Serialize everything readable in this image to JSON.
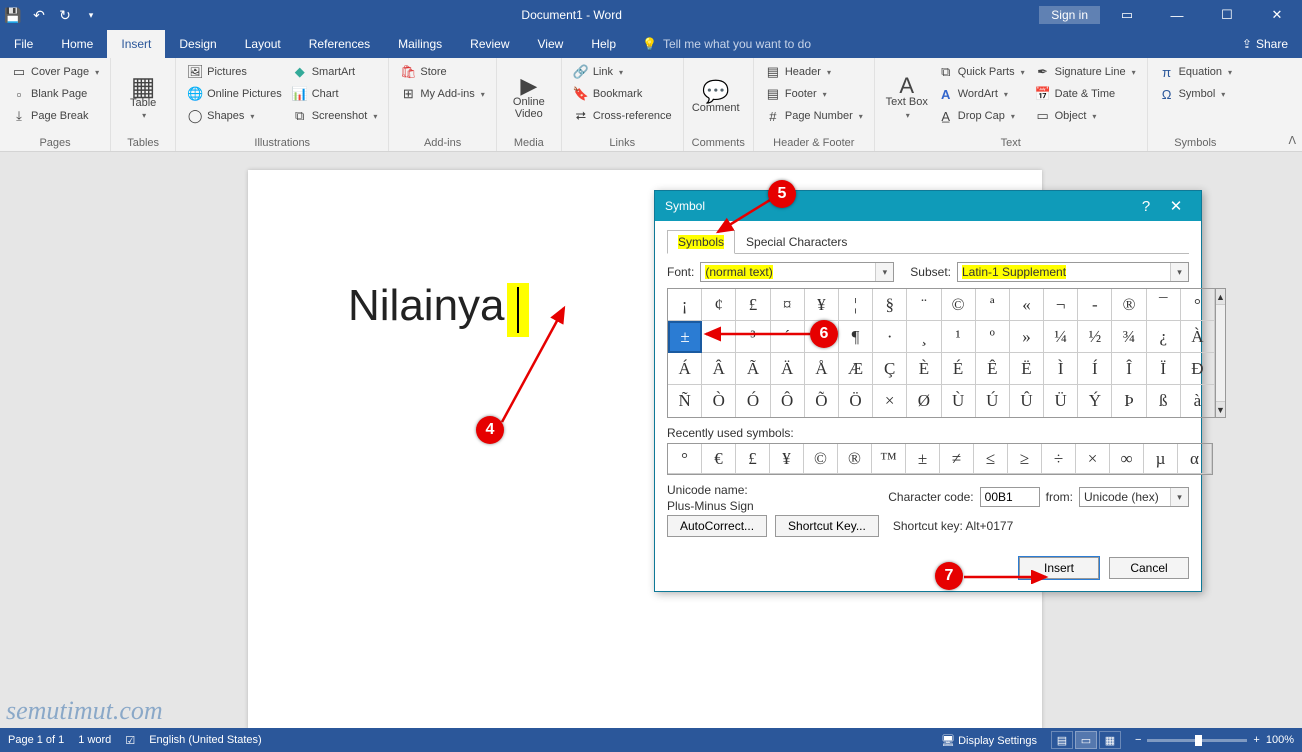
{
  "titlebar": {
    "title": "Document1 - Word",
    "signin": "Sign in"
  },
  "tabs": {
    "items": [
      "File",
      "Home",
      "Insert",
      "Design",
      "Layout",
      "References",
      "Mailings",
      "Review",
      "View",
      "Help"
    ],
    "active": "Insert",
    "tellme": "Tell me what you want to do",
    "share": "Share"
  },
  "ribbon": {
    "pages": {
      "label": "Pages",
      "cover": "Cover Page",
      "blank": "Blank Page",
      "break": "Page Break"
    },
    "tables": {
      "label": "Tables",
      "table": "Table"
    },
    "illus": {
      "label": "Illustrations",
      "pictures": "Pictures",
      "online": "Online Pictures",
      "shapes": "Shapes",
      "smartart": "SmartArt",
      "chart": "Chart",
      "screenshot": "Screenshot"
    },
    "addins": {
      "label": "Add-ins",
      "store": "Store",
      "my": "My Add-ins"
    },
    "media": {
      "label": "Media",
      "video": "Online Video"
    },
    "links": {
      "label": "Links",
      "link": "Link",
      "bookmark": "Bookmark",
      "crossref": "Cross-reference"
    },
    "comments": {
      "label": "Comments",
      "comment": "Comment"
    },
    "hf": {
      "label": "Header & Footer",
      "header": "Header",
      "footer": "Footer",
      "pagenum": "Page Number"
    },
    "text": {
      "label": "Text",
      "textbox": "Text Box",
      "quick": "Quick Parts",
      "wordart": "WordArt",
      "dropcap": "Drop Cap",
      "sig": "Signature Line",
      "date": "Date & Time",
      "object": "Object"
    },
    "symbols": {
      "label": "Symbols",
      "equation": "Equation",
      "symbol": "Symbol"
    }
  },
  "document": {
    "text": "Nilainya"
  },
  "dialog": {
    "title": "Symbol",
    "tabs": {
      "symbols": "Symbols",
      "special": "Special Characters"
    },
    "font_label": "Font:",
    "font_value": "(normal text)",
    "subset_label": "Subset:",
    "subset_value": "Latin-1 Supplement",
    "grid": [
      [
        "¡",
        "¢",
        "£",
        "¤",
        "¥",
        "¦",
        "§",
        "¨",
        "©",
        "ª",
        "«",
        "¬",
        "-",
        "®",
        "¯",
        "°"
      ],
      [
        "±",
        "²",
        "³",
        "´",
        "µ",
        "¶",
        "·",
        "¸",
        "¹",
        "º",
        "»",
        "¼",
        "½",
        "¾",
        "¿",
        "À"
      ],
      [
        "Á",
        "Â",
        "Ã",
        "Ä",
        "Å",
        "Æ",
        "Ç",
        "È",
        "É",
        "Ê",
        "Ë",
        "Ì",
        "Í",
        "Î",
        "Ï",
        "Ð"
      ],
      [
        "Ñ",
        "Ò",
        "Ó",
        "Ô",
        "Õ",
        "Ö",
        "×",
        "Ø",
        "Ù",
        "Ú",
        "Û",
        "Ü",
        "Ý",
        "Þ",
        "ß",
        "à"
      ]
    ],
    "selected": "±",
    "recent_label": "Recently used symbols:",
    "recent": [
      "°",
      "€",
      "£",
      "¥",
      "©",
      "®",
      "™",
      "±",
      "≠",
      "≤",
      "≥",
      "÷",
      "×",
      "∞",
      "µ",
      "α"
    ],
    "uname_label": "Unicode name:",
    "uname": "Plus-Minus Sign",
    "ccode_label": "Character code:",
    "ccode": "00B1",
    "from_label": "from:",
    "from_value": "Unicode (hex)",
    "autocorrect": "AutoCorrect...",
    "shortcutkey_btn": "Shortcut Key...",
    "shortcut_label": "Shortcut key: Alt+0177",
    "insert": "Insert",
    "cancel": "Cancel"
  },
  "statusbar": {
    "page": "Page 1 of 1",
    "words": "1 word",
    "lang": "English (United States)",
    "display": "Display Settings",
    "zoom": "100%"
  },
  "callouts": {
    "c4": "4",
    "c5": "5",
    "c6": "6",
    "c7": "7"
  },
  "watermark": "semutimut.com"
}
